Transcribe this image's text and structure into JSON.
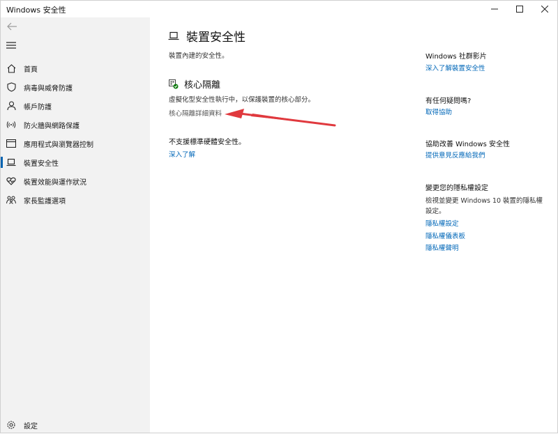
{
  "window": {
    "title": "Windows 安全性"
  },
  "sidebar": {
    "items": [
      {
        "label": "首頁",
        "icon": "home-icon"
      },
      {
        "label": "病毒與威脅防護",
        "icon": "shield-icon"
      },
      {
        "label": "帳戶防護",
        "icon": "person-icon"
      },
      {
        "label": "防火牆與網路保護",
        "icon": "wireless-icon"
      },
      {
        "label": "應用程式與瀏覽器控制",
        "icon": "app-window-icon"
      },
      {
        "label": "裝置安全性",
        "icon": "laptop-icon",
        "active": true
      },
      {
        "label": "裝置效能與運作狀況",
        "icon": "heart-icon"
      },
      {
        "label": "家長監護選項",
        "icon": "family-icon"
      }
    ],
    "settings_label": "設定"
  },
  "main": {
    "title": "裝置安全性",
    "subtitle": "裝置內建的安全性。",
    "core_isolation": {
      "title": "核心隔離",
      "description": "虛擬化型安全性執行中，以保護裝置的核心部分。",
      "details_link": "核心隔離詳細資料"
    },
    "unsupported": {
      "text": "不支援標準硬體安全性。",
      "learn_more": "深入了解"
    }
  },
  "right_panel": {
    "community": {
      "heading": "Windows 社群影片",
      "link": "深入了解裝置安全性"
    },
    "help": {
      "heading": "有任何疑問嗎?",
      "link": "取得協助"
    },
    "improve": {
      "heading": "協助改善 Windows 安全性",
      "link": "提供意見反應給我們"
    },
    "privacy": {
      "heading": "變更您的隱私權設定",
      "text": "檢視並變更 Windows 10 裝置的隱私權設定。",
      "links": [
        "隱私權設定",
        "隱私權儀表板",
        "隱私權聲明"
      ]
    }
  },
  "colors": {
    "accent": "#0067b8",
    "sidebar_bg": "#f2f2f2",
    "arrow": "#e0393e"
  }
}
